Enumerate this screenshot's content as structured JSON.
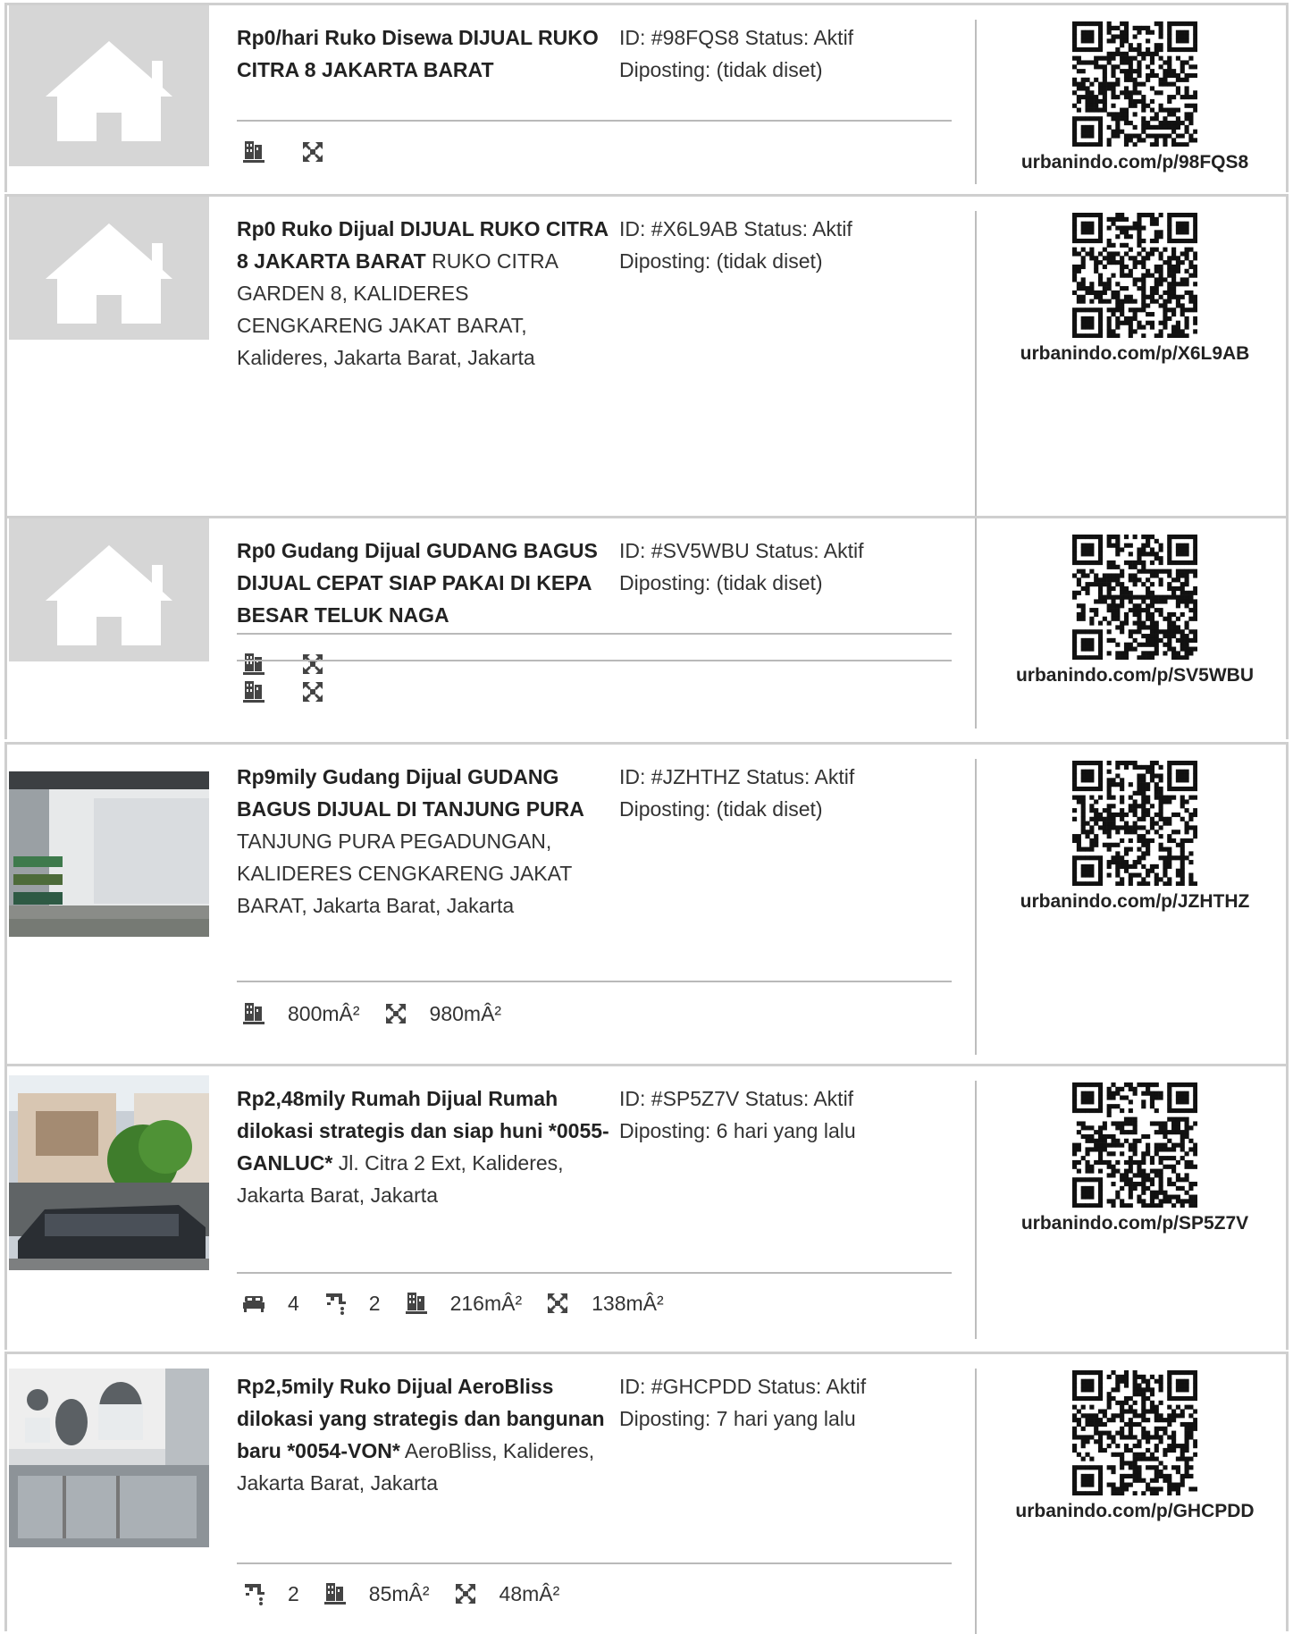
{
  "listings": [
    {
      "title": "Rp0/hari Ruko Disewa DIJUAL RUKO CITRA 8 JAKARTA BARAT",
      "address": "",
      "id_status": "ID: #98FQS8 Status: Aktif",
      "posted": "Diposting: (tidak diset)",
      "image": "placeholder",
      "features": [
        {
          "icon": "building-area-icon",
          "value": ""
        },
        {
          "icon": "land-area-icon",
          "value": ""
        }
      ],
      "qr_url": "urbanindo.com/p/98FQS8"
    },
    {
      "title": "Rp0 Ruko Dijual DIJUAL RUKO CITRA 8 JAKARTA BARAT",
      "address": " RUKO CITRA GARDEN 8, KALIDERES CENGKARENG JAKAT BARAT, Kalideres, Jakarta Barat, Jakarta",
      "id_status": "ID: #X6L9AB Status: Aktif",
      "posted": "Diposting: (tidak diset)",
      "image": "placeholder",
      "features": [
        {
          "icon": "building-area-icon",
          "value": ""
        },
        {
          "icon": "land-area-icon",
          "value": ""
        }
      ],
      "qr_url": "urbanindo.com/p/X6L9AB"
    },
    {
      "title": "Rp0 Gudang Dijual GUDANG BAGUS DIJUAL CEPAT SIAP PAKAI DI KEPA BESAR TELUK NAGA",
      "address": "",
      "id_status": "ID: #SV5WBU Status: Aktif",
      "posted": "Diposting: (tidak diset)",
      "image": "placeholder",
      "features": [
        {
          "icon": "building-area-icon",
          "value": ""
        },
        {
          "icon": "land-area-icon",
          "value": ""
        }
      ],
      "qr_url": "urbanindo.com/p/SV5WBU"
    },
    {
      "title": "Rp9mily Gudang Dijual GUDANG BAGUS DIJUAL DI TANJUNG PURA",
      "address": " TANJUNG PURA PEGADUNGAN, KALIDERES CENGKARENG JAKAT BARAT, Jakarta Barat, Jakarta",
      "id_status": "ID: #JZHTHZ Status: Aktif",
      "posted": "Diposting: (tidak diset)",
      "image": "warehouse",
      "features": [
        {
          "icon": "building-area-icon",
          "value": "800mÂ²"
        },
        {
          "icon": "land-area-icon",
          "value": "980mÂ²"
        }
      ],
      "qr_url": "urbanindo.com/p/JZHTHZ"
    },
    {
      "title": "Rp2,48mily Rumah Dijual Rumah dilokasi strategis dan siap huni *0055-GANLUC*",
      "address": " Jl. Citra 2 Ext, Kalideres, Jakarta Barat, Jakarta",
      "id_status": "ID: #SP5Z7V Status: Aktif",
      "posted": "Diposting: 6 hari yang lalu",
      "image": "house",
      "features": [
        {
          "icon": "bed-icon",
          "value": "4"
        },
        {
          "icon": "bath-icon",
          "value": "2"
        },
        {
          "icon": "building-area-icon",
          "value": "216mÂ²"
        },
        {
          "icon": "land-area-icon",
          "value": "138mÂ²"
        }
      ],
      "qr_url": "urbanindo.com/p/SP5Z7V"
    },
    {
      "title": "Rp2,5mily Ruko Dijual AeroBliss dilokasi yang strategis dan bangunan baru *0054-VON*",
      "address": " AeroBliss, Kalideres, Jakarta Barat, Jakarta",
      "id_status": "ID: #GHCPDD Status: Aktif",
      "posted": "Diposting: 7 hari yang lalu",
      "image": "shophouse",
      "features": [
        {
          "icon": "bath-icon",
          "value": "2"
        },
        {
          "icon": "building-area-icon",
          "value": "85mÂ²"
        },
        {
          "icon": "land-area-icon",
          "value": "48mÂ²"
        }
      ],
      "qr_url": "urbanindo.com/p/GHCPDD"
    }
  ]
}
